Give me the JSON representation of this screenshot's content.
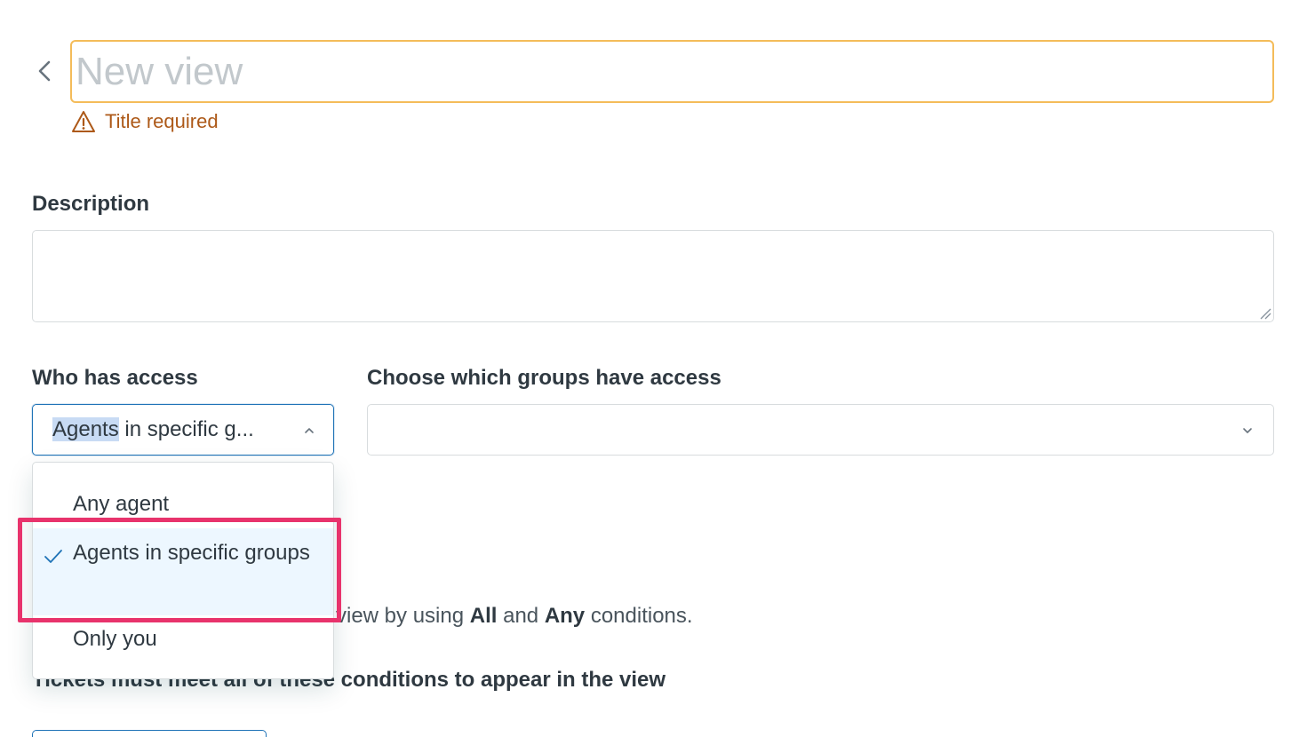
{
  "header": {
    "title_placeholder": "New view",
    "title_value": "",
    "validation_message": "Title required"
  },
  "description": {
    "label": "Description",
    "value": ""
  },
  "access": {
    "label": "Who has access",
    "selected_highlight": "Agents",
    "selected_rest": " in specific g...",
    "options": [
      "Any agent",
      "Agents in specific groups",
      "Only you"
    ],
    "selected_index": 1
  },
  "groups": {
    "label": "Choose which groups have access",
    "value": ""
  },
  "conditions": {
    "hint_prefix": "view by using ",
    "hint_all": "All",
    "hint_and": " and ",
    "hint_any": "Any",
    "hint_suffix": " conditions.",
    "heading": "Tickets must meet all of these conditions to appear in the view"
  },
  "colors": {
    "accent": "#1f73b7",
    "warning": "#ad5918",
    "warning_border": "#f4bc5a",
    "annotation": "#e8336c"
  },
  "icons": {
    "back": "chevron-left-icon",
    "warning": "warning-triangle-icon",
    "select_open": "chevron-up-icon",
    "select_closed": "chevron-down-icon",
    "selected_check": "check-icon"
  }
}
